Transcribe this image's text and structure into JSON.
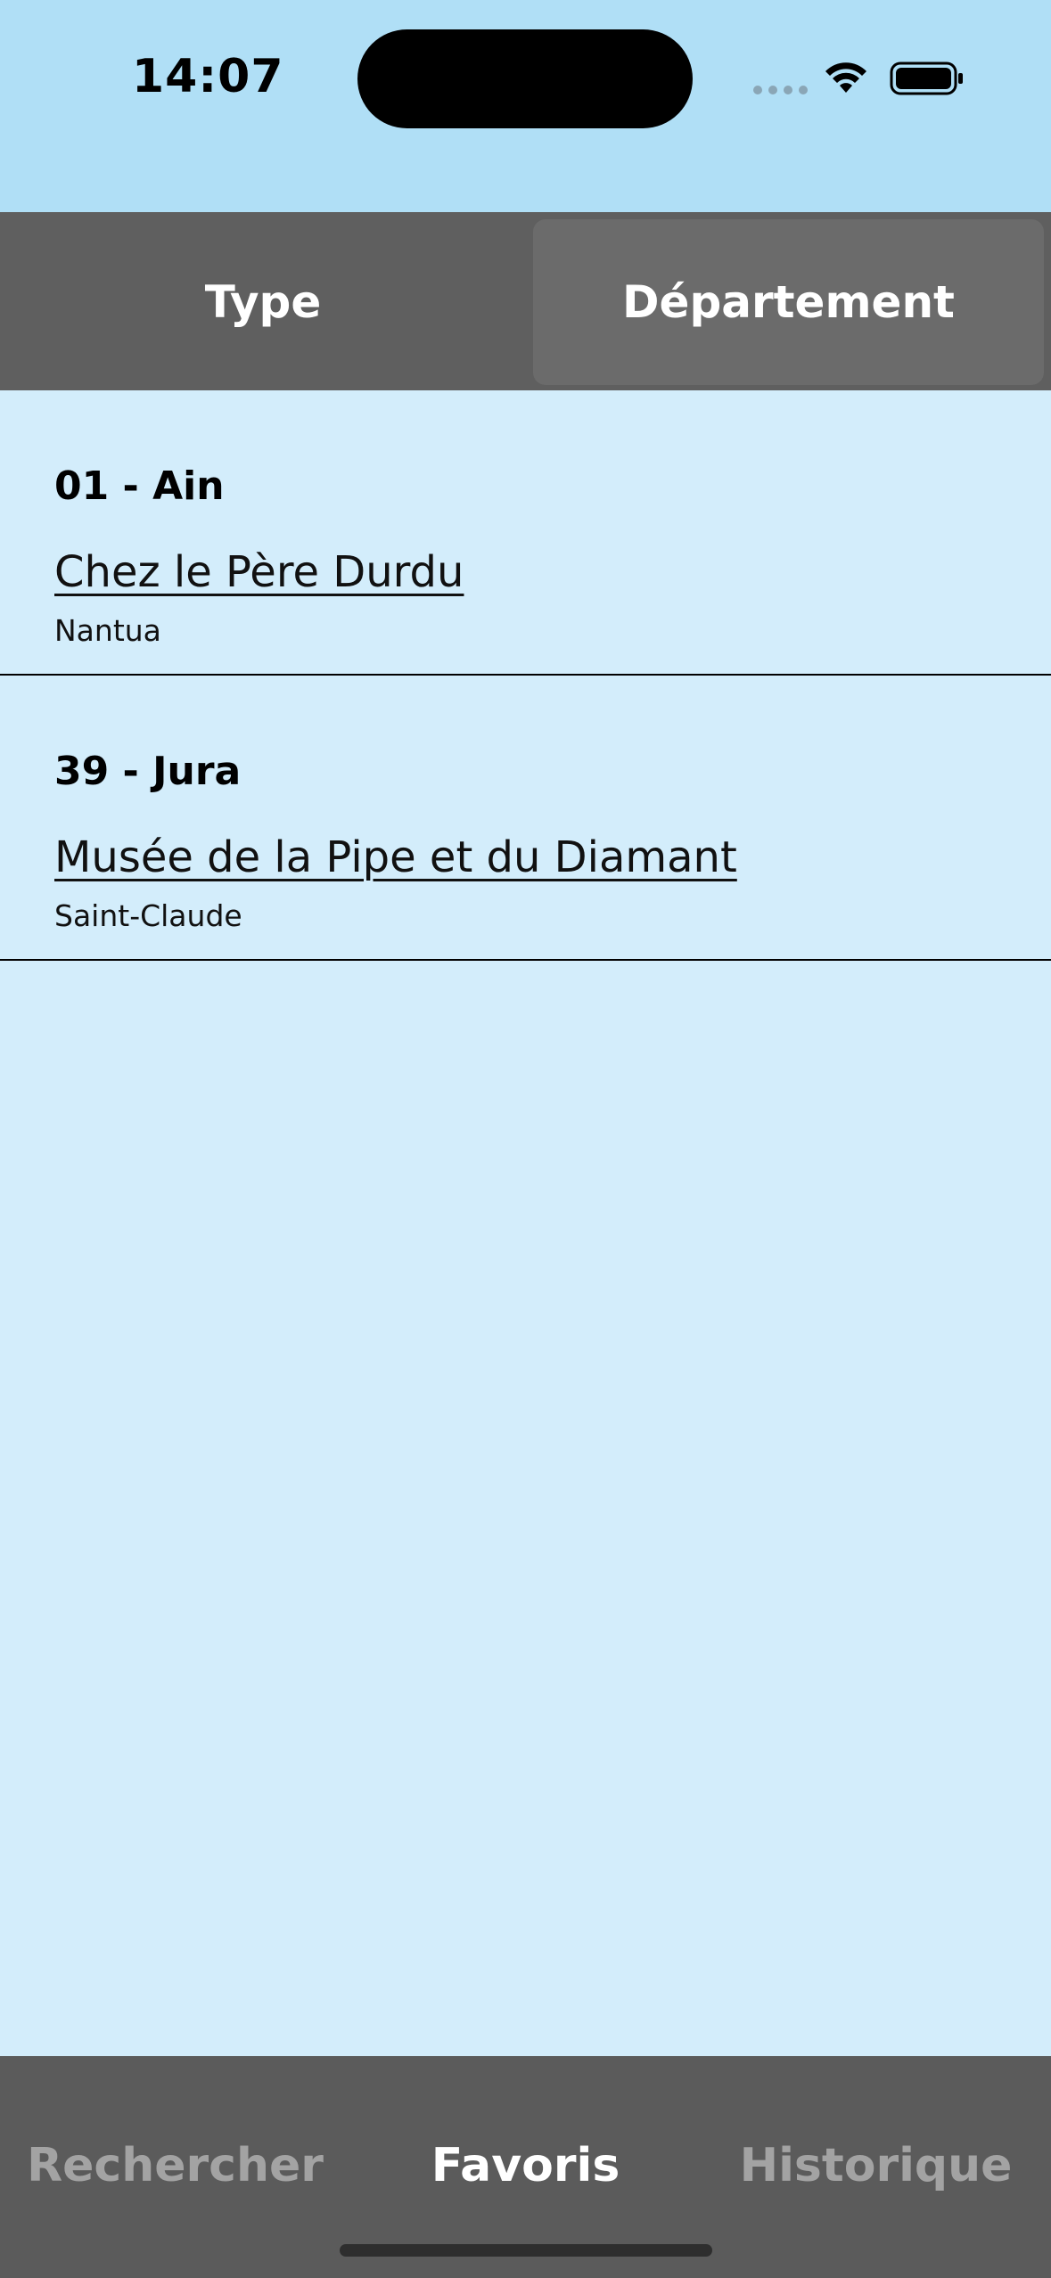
{
  "status": {
    "time": "14:07"
  },
  "segments": {
    "type_label": "Type",
    "department_label": "Département",
    "selected": "Département"
  },
  "sections": [
    {
      "title": "01 - Ain",
      "item_name": "Chez le Père Durdu",
      "item_city": "Nantua"
    },
    {
      "title": "39 - Jura",
      "item_name": "Musée de la Pipe et du Diamant",
      "item_city": "Saint-Claude"
    }
  ],
  "tabs": {
    "search_label": "Rechercher",
    "favorites_label": "Favoris",
    "history_label": "Historique",
    "selected": "Favoris"
  },
  "colors": {
    "status_bar_bg": "#b0dff6",
    "content_bg": "#d3edfb",
    "header_bg": "#5f5f5f",
    "tab_bar_bg": "#5b5b5b",
    "tab_active": "#ffffff",
    "tab_inactive": "#a3a3a3"
  },
  "icons": {
    "signal": "cellular-signal-icon",
    "wifi": "wifi-icon",
    "battery": "battery-icon"
  }
}
